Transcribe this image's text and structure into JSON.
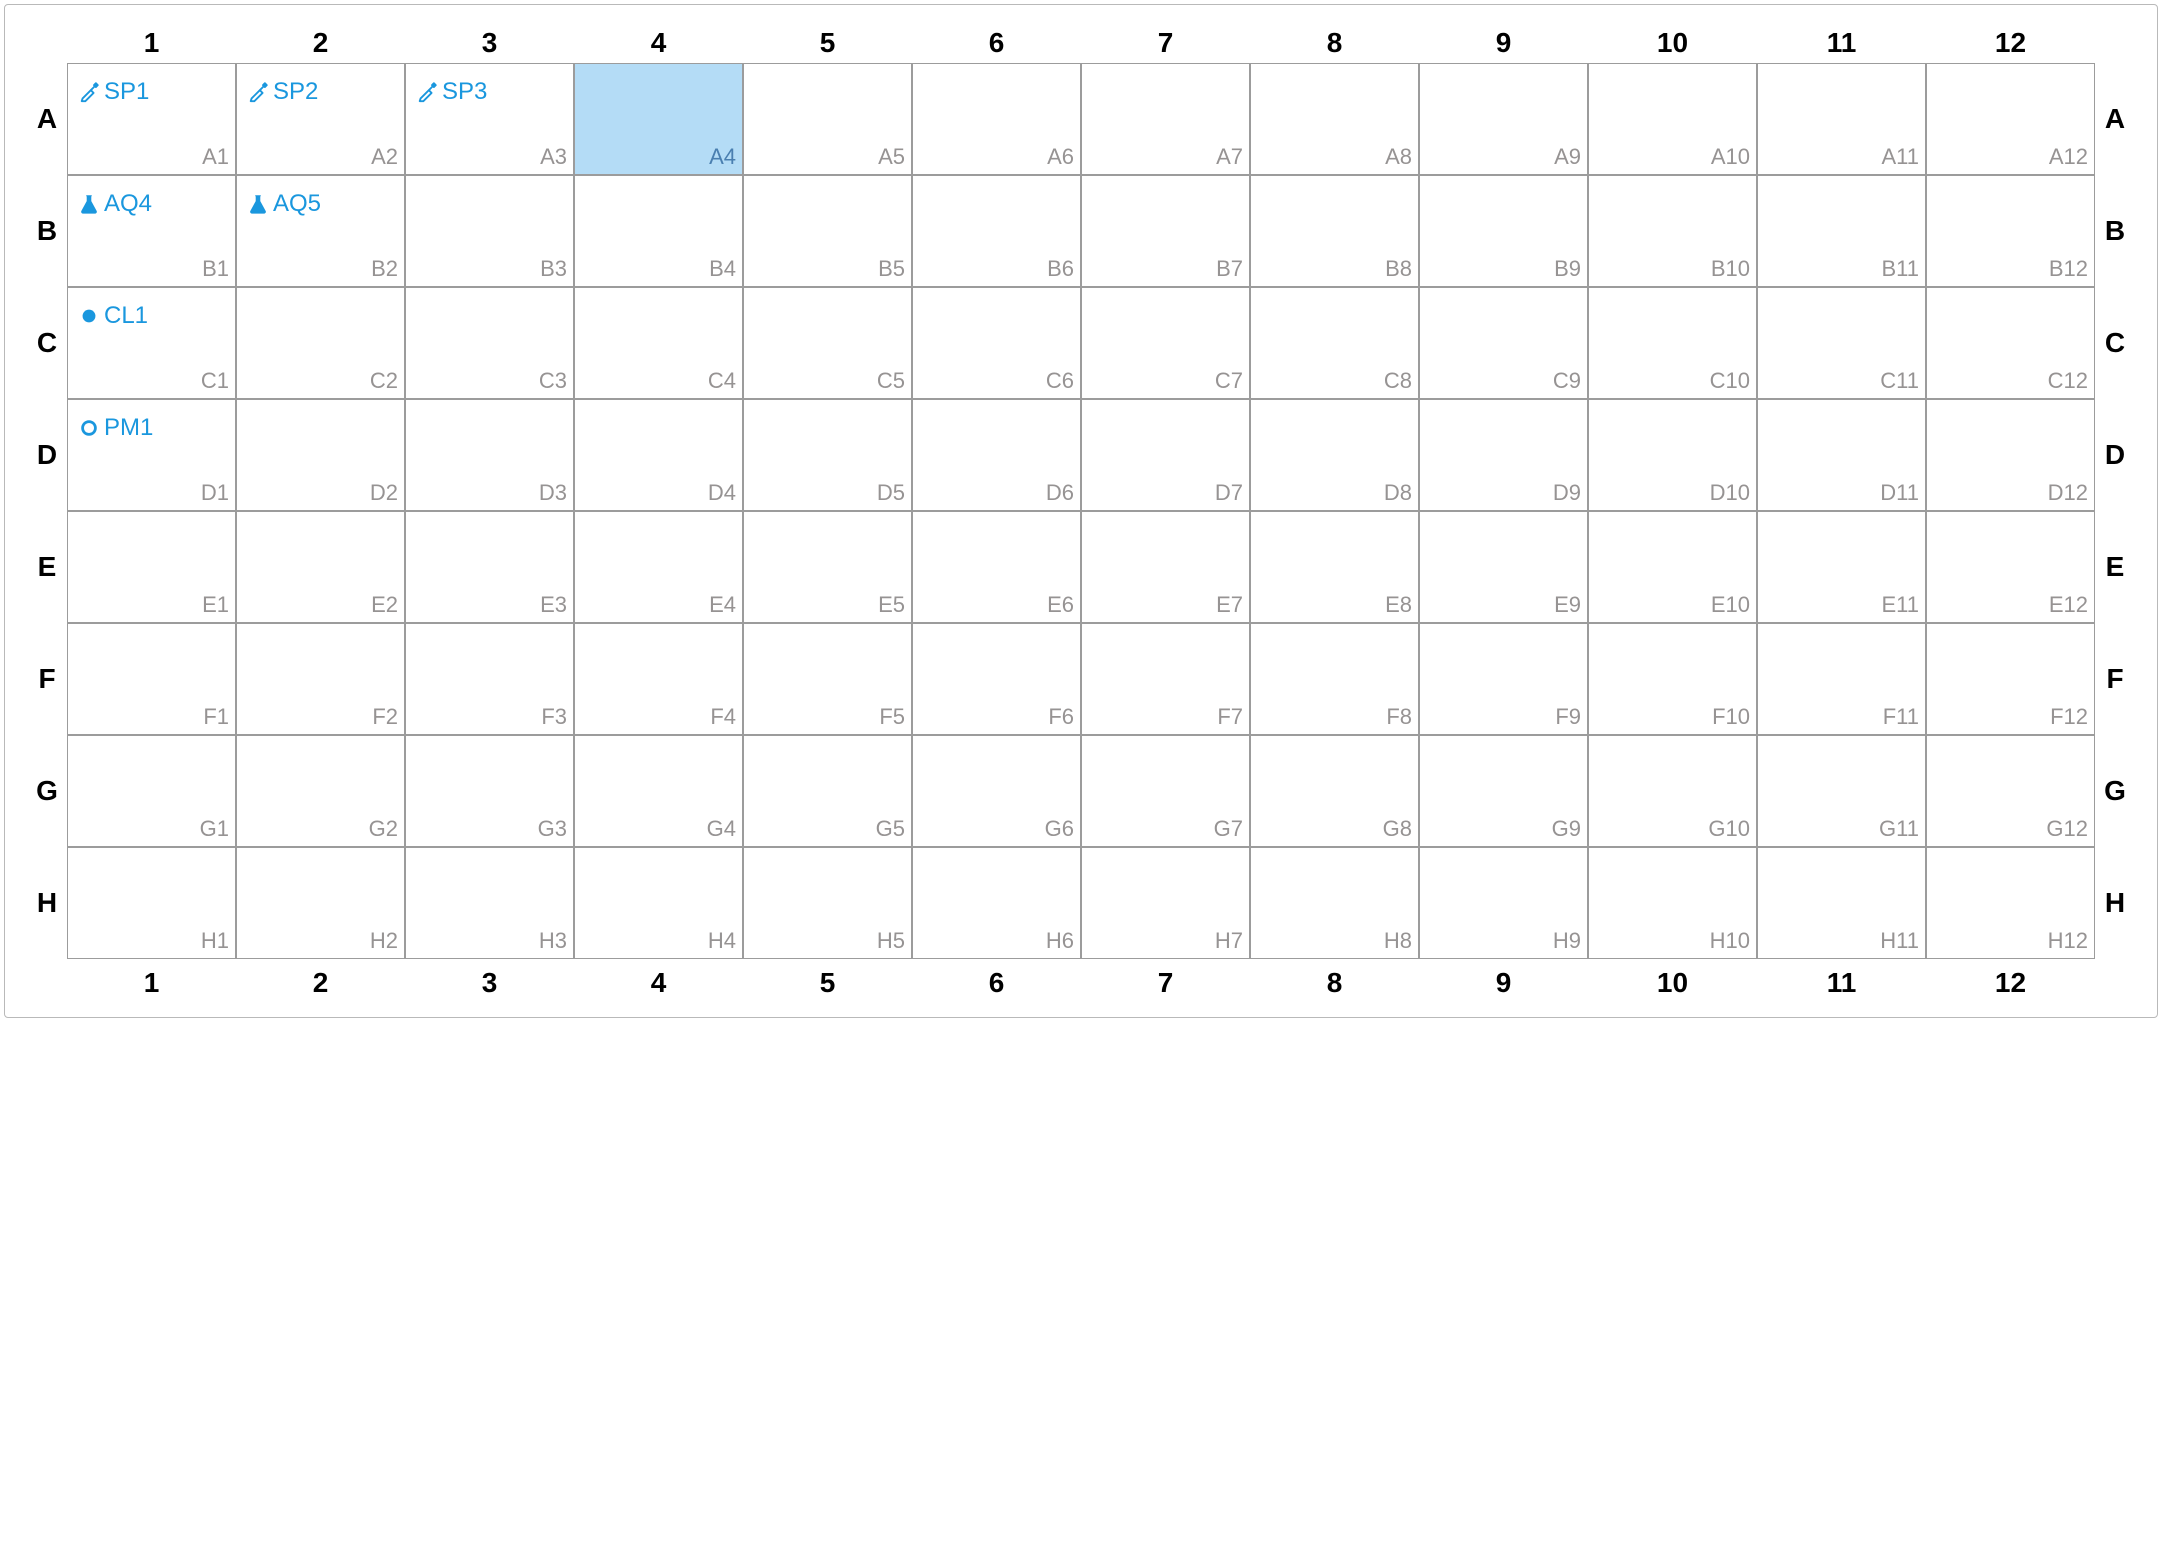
{
  "plate": {
    "rows": [
      "A",
      "B",
      "C",
      "D",
      "E",
      "F",
      "G",
      "H"
    ],
    "cols": [
      "1",
      "2",
      "3",
      "4",
      "5",
      "6",
      "7",
      "8",
      "9",
      "10",
      "11",
      "12"
    ],
    "selected": [
      "A4"
    ],
    "samples": {
      "A1": {
        "label": "SP1",
        "icon": "pipette"
      },
      "A2": {
        "label": "SP2",
        "icon": "pipette"
      },
      "A3": {
        "label": "SP3",
        "icon": "pipette"
      },
      "B1": {
        "label": "AQ4",
        "icon": "flask"
      },
      "B2": {
        "label": "AQ5",
        "icon": "flask"
      },
      "C1": {
        "label": "CL1",
        "icon": "dot-filled"
      },
      "D1": {
        "label": "PM1",
        "icon": "dot-open"
      }
    }
  },
  "icons": {
    "pipette": "pipette-icon",
    "flask": "flask-icon",
    "dot-filled": "dot-filled-icon",
    "dot-open": "dot-open-icon"
  },
  "colors": {
    "accent": "#1a97de",
    "selected": "#b4dcf6",
    "grid": "#9c9c9c",
    "muted": "#969393"
  }
}
